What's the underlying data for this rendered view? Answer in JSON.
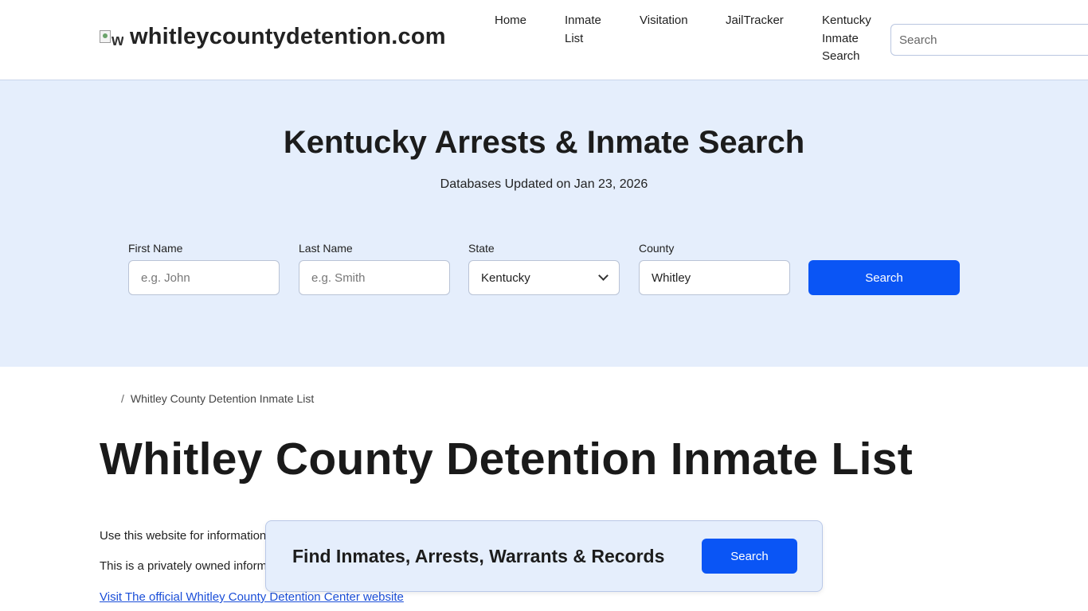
{
  "header": {
    "logo_alt": "w",
    "site_name": "whitleycountydetention.com",
    "nav": [
      {
        "label_lines": [
          "Home"
        ]
      },
      {
        "label_lines": [
          "Inmate",
          "List"
        ]
      },
      {
        "label_lines": [
          "Visitation"
        ]
      },
      {
        "label_lines": [
          "JailTracker"
        ]
      },
      {
        "label_lines": [
          "Kentucky",
          "Inmate",
          "Search"
        ]
      }
    ],
    "search_placeholder": "Search"
  },
  "hero": {
    "title": "Kentucky Arrests & Inmate Search",
    "subtitle": "Databases Updated on Jan 23, 2026",
    "form": {
      "first_name_label": "First Name",
      "first_name_placeholder": "e.g. John",
      "last_name_label": "Last Name",
      "last_name_placeholder": "e.g. Smith",
      "state_label": "State",
      "state_value": "Kentucky",
      "county_label": "County",
      "county_value": "Whitley",
      "submit_label": "Search"
    }
  },
  "breadcrumb": {
    "separator": "/",
    "current": "Whitley County Detention Inmate List"
  },
  "main": {
    "title": "Whitley County Detention Inmate List",
    "paragraph_1": "Use this website for information",
    "paragraph_2": "This is a privately owned inform",
    "official_link": "Visit The official Whitley County Detention Center website"
  },
  "floating_banner": {
    "text": "Find Inmates, Arrests, Warrants & Records",
    "button_label": "Search"
  },
  "colors": {
    "hero_background": "#e5eefc",
    "primary_button": "#0a55f5",
    "link": "#1a4ed8"
  }
}
